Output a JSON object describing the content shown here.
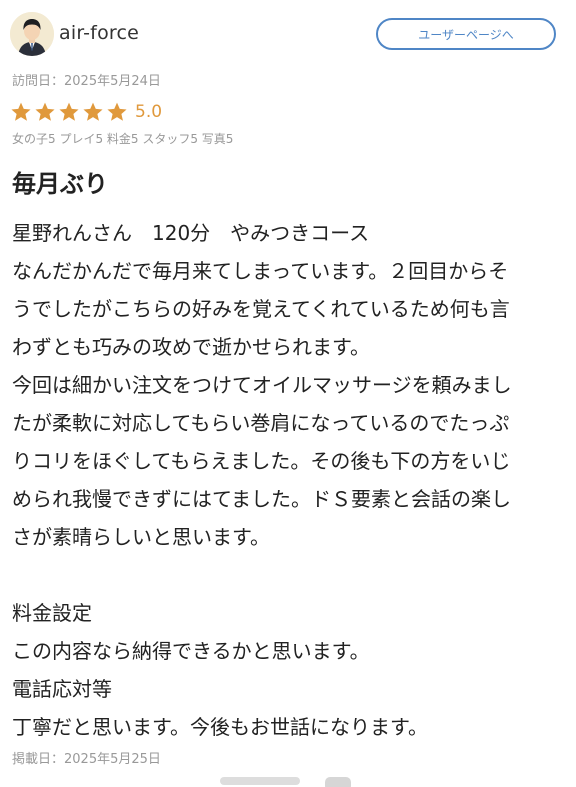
{
  "user": {
    "name": "air-force",
    "user_page_label": "ユーザーページへ"
  },
  "visit": {
    "label": "訪問日：2025年5月24日"
  },
  "rating": {
    "stars": 5,
    "max_stars": 5,
    "score": "5.0",
    "star_color": "#e0993c",
    "breakdown": "女の子5 プレイ5 料金5 スタッフ5 写真5"
  },
  "review": {
    "title": "毎月ぶり",
    "lines": [
      "星野れんさん　120分　やみつきコース",
      "なんだかんだで毎月来てしまっています。２回目からそ",
      "うでしたがこちらの好みを覚えてくれているため何も言",
      "わずとも巧みの攻めで逝かせられます。",
      "今回は細かい注文をつけてオイルマッサージを頼みまし",
      "たが柔軟に対応してもらい巻肩になっているのでたっぷ",
      "りコリをほぐしてもらえました。その後も下の方をいじ",
      "められ我慢できずにはてました。ドＳ要素と会話の楽し",
      "さが素晴らしいと思います。",
      "",
      "料金設定",
      "この内容なら納得できるかと思います。",
      "電話応対等",
      "丁寧だと思います。今後もお世話になります。"
    ]
  },
  "posted": {
    "label": "掲載日：2025年5月25日"
  },
  "colors": {
    "accent_blue": "#4f86c6",
    "muted_text": "#999999"
  }
}
